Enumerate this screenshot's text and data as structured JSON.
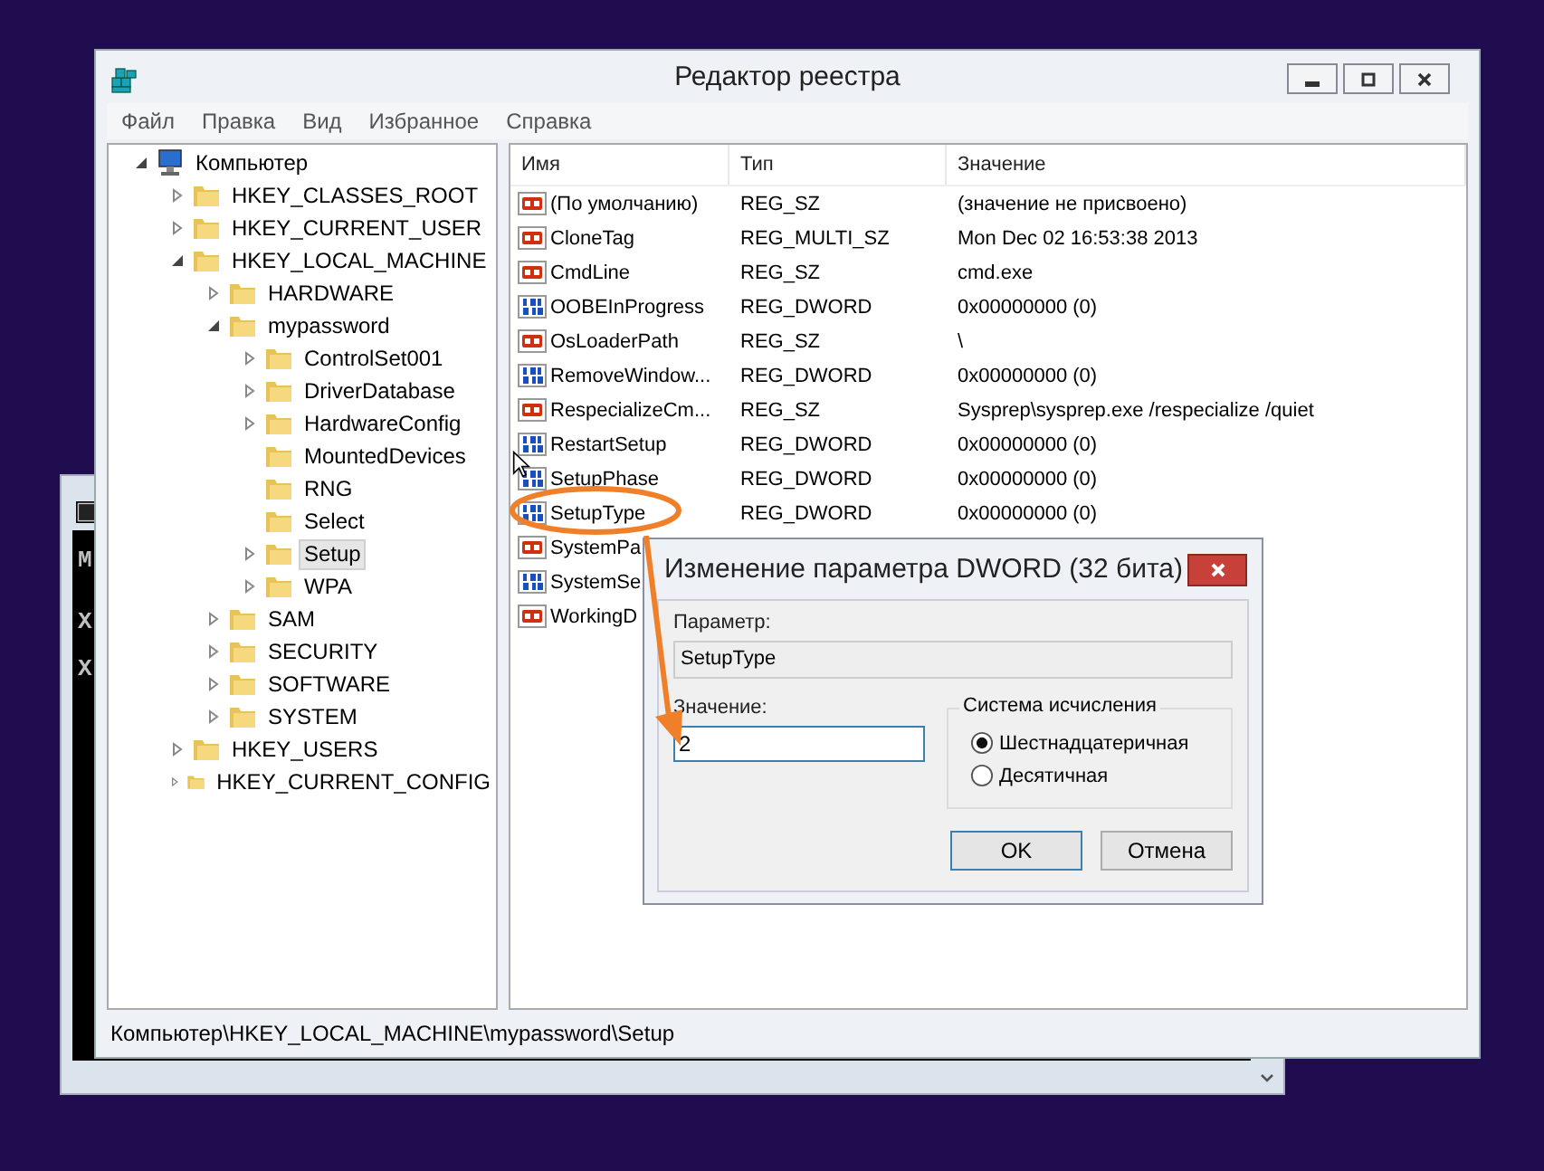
{
  "console": {
    "lines": [
      "M",
      "X",
      "X"
    ]
  },
  "window": {
    "title": "Редактор реестра"
  },
  "menu": [
    "Файл",
    "Правка",
    "Вид",
    "Избранное",
    "Справка"
  ],
  "tree": [
    {
      "label": "Компьютер",
      "kind": "computer",
      "expanded": true,
      "selected": false,
      "children": [
        {
          "label": "HKEY_CLASSES_ROOT",
          "kind": "folder",
          "expanded": false,
          "selected": false
        },
        {
          "label": "HKEY_CURRENT_USER",
          "kind": "folder",
          "expanded": false,
          "selected": false
        },
        {
          "label": "HKEY_LOCAL_MACHINE",
          "kind": "folder",
          "expanded": true,
          "selected": false,
          "children": [
            {
              "label": "HARDWARE",
              "kind": "folder",
              "expanded": false,
              "selected": false
            },
            {
              "label": "mypassword",
              "kind": "folder",
              "expanded": true,
              "selected": false,
              "children": [
                {
                  "label": "ControlSet001",
                  "kind": "folder",
                  "expanded": false,
                  "selected": false
                },
                {
                  "label": "DriverDatabase",
                  "kind": "folder",
                  "expanded": false,
                  "selected": false
                },
                {
                  "label": "HardwareConfig",
                  "kind": "folder",
                  "expanded": false,
                  "selected": false
                },
                {
                  "label": "MountedDevices",
                  "kind": "leaf",
                  "selected": false
                },
                {
                  "label": "RNG",
                  "kind": "leaf",
                  "selected": false
                },
                {
                  "label": "Select",
                  "kind": "leaf",
                  "selected": false
                },
                {
                  "label": "Setup",
                  "kind": "folder",
                  "expanded": false,
                  "selected": true
                },
                {
                  "label": "WPA",
                  "kind": "folder",
                  "expanded": false,
                  "selected": false
                }
              ]
            },
            {
              "label": "SAM",
              "kind": "folder",
              "expanded": false,
              "selected": false
            },
            {
              "label": "SECURITY",
              "kind": "folder",
              "expanded": false,
              "selected": false
            },
            {
              "label": "SOFTWARE",
              "kind": "folder",
              "expanded": false,
              "selected": false
            },
            {
              "label": "SYSTEM",
              "kind": "folder",
              "expanded": false,
              "selected": false
            }
          ]
        },
        {
          "label": "HKEY_USERS",
          "kind": "folder",
          "expanded": false,
          "selected": false
        },
        {
          "label": "HKEY_CURRENT_CONFIG",
          "kind": "folder",
          "expanded": false,
          "selected": false
        }
      ]
    }
  ],
  "table": {
    "columns": [
      "Имя",
      "Тип",
      "Значение"
    ],
    "rows": [
      {
        "kind": "string",
        "name": "(По умолчанию)",
        "type": "REG_SZ",
        "value": "(значение не присвоено)"
      },
      {
        "kind": "string",
        "name": "CloneTag",
        "type": "REG_MULTI_SZ",
        "value": "Mon Dec 02 16:53:38 2013"
      },
      {
        "kind": "string",
        "name": "CmdLine",
        "type": "REG_SZ",
        "value": "cmd.exe"
      },
      {
        "kind": "binary",
        "name": "OOBEInProgress",
        "type": "REG_DWORD",
        "value": "0x00000000 (0)"
      },
      {
        "kind": "string",
        "name": "OsLoaderPath",
        "type": "REG_SZ",
        "value": "\\"
      },
      {
        "kind": "binary",
        "name": "RemoveWindow...",
        "type": "REG_DWORD",
        "value": "0x00000000 (0)"
      },
      {
        "kind": "string",
        "name": "RespecializeCm...",
        "type": "REG_SZ",
        "value": "Sysprep\\sysprep.exe /respecialize /quiet"
      },
      {
        "kind": "binary",
        "name": "RestartSetup",
        "type": "REG_DWORD",
        "value": "0x00000000 (0)"
      },
      {
        "kind": "binary",
        "name": "SetupPhase",
        "type": "REG_DWORD",
        "value": "0x00000000 (0)"
      },
      {
        "kind": "binary",
        "name": "SetupType",
        "type": "REG_DWORD",
        "value": "0x00000000 (0)"
      },
      {
        "kind": "string",
        "name": "SystemPa"
      },
      {
        "kind": "binary",
        "name": "SystemSe"
      },
      {
        "kind": "string",
        "name": "WorkingD"
      }
    ]
  },
  "status_bar": "Компьютер\\HKEY_LOCAL_MACHINE\\mypassword\\Setup",
  "dialog": {
    "title": "Изменение параметра DWORD (32 бита)",
    "param_label": "Параметр:",
    "param_value": "SetupType",
    "value_label": "Значение:",
    "value": "2",
    "group_label": "Система исчисления",
    "radios": [
      {
        "label": "Шестнадцатеричная",
        "selected": true
      },
      {
        "label": "Десятичная",
        "selected": false
      }
    ],
    "buttons": [
      "OK",
      "Отмена"
    ]
  }
}
